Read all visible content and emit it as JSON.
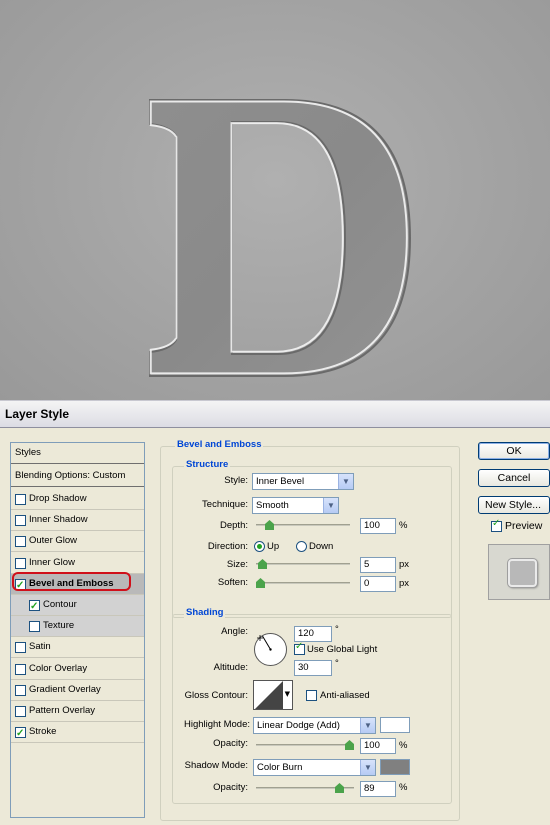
{
  "canvas": {
    "letter": "D"
  },
  "dialog": {
    "title": "Layer Style",
    "styles_list": {
      "header": "Styles",
      "blending": "Blending Options: Custom",
      "items": [
        {
          "label": "Drop Shadow",
          "checked": false
        },
        {
          "label": "Inner Shadow",
          "checked": false
        },
        {
          "label": "Outer Glow",
          "checked": false
        },
        {
          "label": "Inner Glow",
          "checked": false
        },
        {
          "label": "Bevel and Emboss",
          "checked": true
        },
        {
          "label": "Contour",
          "checked": true
        },
        {
          "label": "Texture",
          "checked": false
        },
        {
          "label": "Satin",
          "checked": false
        },
        {
          "label": "Color Overlay",
          "checked": false
        },
        {
          "label": "Gradient Overlay",
          "checked": false
        },
        {
          "label": "Pattern Overlay",
          "checked": false
        },
        {
          "label": "Stroke",
          "checked": true
        }
      ]
    },
    "bevel": {
      "section": "Bevel and Emboss",
      "structure": {
        "title": "Structure",
        "style_label": "Style:",
        "style_value": "Inner Bevel",
        "technique_label": "Technique:",
        "technique_value": "Smooth",
        "depth_label": "Depth:",
        "depth_value": "100",
        "depth_unit": "%",
        "depth_level": 0.1,
        "direction_label": "Direction:",
        "dir_up": "Up",
        "dir_down": "Down",
        "size_label": "Size:",
        "size_value": "5",
        "size_unit": "px",
        "size_level": 0.02,
        "soften_label": "Soften:",
        "soften_value": "0",
        "soften_unit": "px",
        "soften_level": 0.0
      },
      "shading": {
        "title": "Shading",
        "angle_label": "Angle:",
        "angle_value": "120",
        "degree": "°",
        "global_light": "Use Global Light",
        "altitude_label": "Altitude:",
        "altitude_value": "30",
        "gloss_label": "Gloss Contour:",
        "anti_aliased": "Anti-aliased",
        "highlight_label": "Highlight Mode:",
        "highlight_mode": "Linear Dodge (Add)",
        "highlight_color": "#ffffff",
        "hl_opacity_label": "Opacity:",
        "hl_opacity_value": "100",
        "hl_opacity_unit": "%",
        "hl_opacity_level": 1.0,
        "shadow_label": "Shadow Mode:",
        "shadow_mode": "Color Burn",
        "shadow_color": "#808080",
        "sh_opacity_label": "Opacity:",
        "sh_opacity_value": "89",
        "sh_opacity_unit": "%",
        "sh_opacity_level": 0.89
      }
    },
    "buttons": {
      "ok": "OK",
      "cancel": "Cancel",
      "new_style": "New Style...",
      "preview": "Preview"
    }
  }
}
